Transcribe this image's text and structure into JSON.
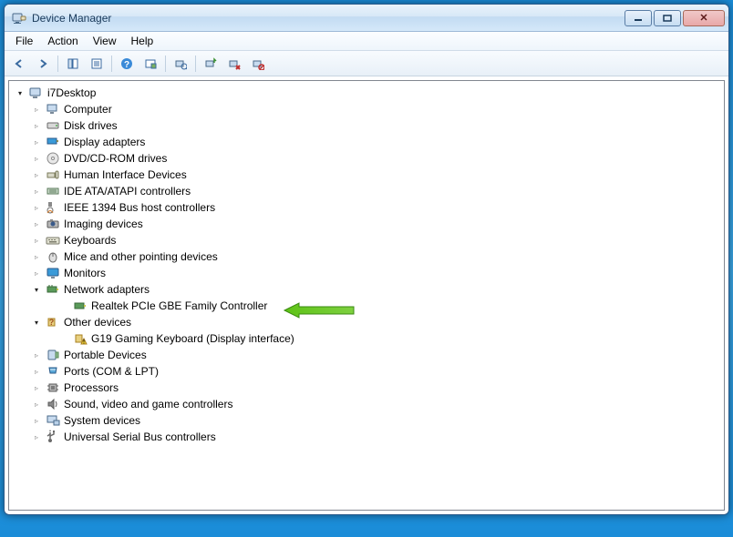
{
  "window": {
    "title": "Device Manager"
  },
  "menubar": {
    "file": "File",
    "action": "Action",
    "view": "View",
    "help": "Help"
  },
  "tree": {
    "root": "i7Desktop",
    "computer": "Computer",
    "disk_drives": "Disk drives",
    "display_adapters": "Display adapters",
    "dvd": "DVD/CD-ROM drives",
    "hid": "Human Interface Devices",
    "ide": "IDE ATA/ATAPI controllers",
    "ieee1394": "IEEE 1394 Bus host controllers",
    "imaging": "Imaging devices",
    "keyboards": "Keyboards",
    "mice": "Mice and other pointing devices",
    "monitors": "Monitors",
    "network_adapters": "Network adapters",
    "realtek": "Realtek PCIe GBE Family Controller",
    "other_devices": "Other devices",
    "g19": "G19 Gaming Keyboard (Display interface)",
    "portable": "Portable Devices",
    "ports": "Ports (COM & LPT)",
    "processors": "Processors",
    "sound": "Sound, video and game controllers",
    "system": "System devices",
    "usb": "Universal Serial Bus controllers"
  },
  "colors": {
    "accent": "#1a8cd8",
    "arrow": "#5ec316"
  }
}
